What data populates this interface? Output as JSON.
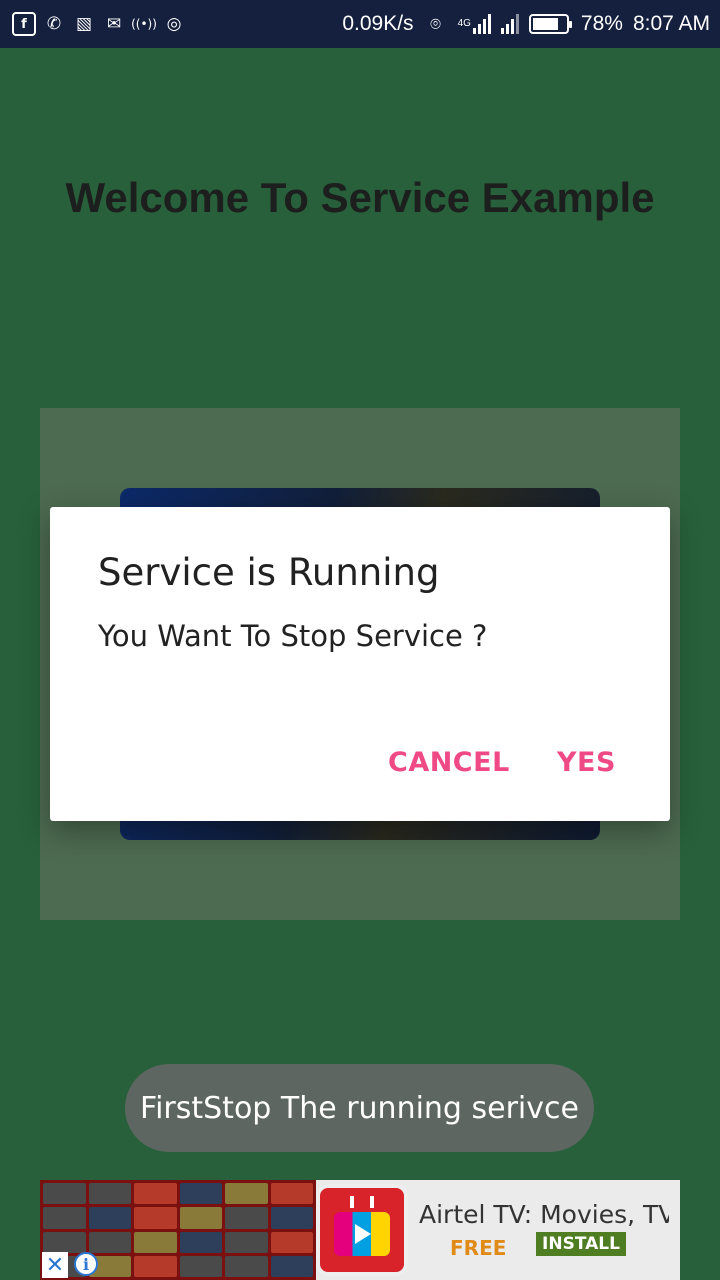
{
  "status_bar": {
    "left_icons": [
      {
        "name": "facebook-icon",
        "glyph": "f"
      },
      {
        "name": "whatsapp-icon",
        "glyph": "✆"
      },
      {
        "name": "gallery-icon",
        "glyph": "▧"
      },
      {
        "name": "mail-icon",
        "glyph": "✉"
      },
      {
        "name": "broadcast-icon",
        "glyph": "((•))"
      },
      {
        "name": "instagram-icon",
        "glyph": "◎"
      }
    ],
    "net_speed": "0.09K/s",
    "network_type": "4G",
    "battery_percent": "78%",
    "battery_level": 0.78,
    "time": "8:07 AM"
  },
  "app": {
    "title": "Welcome To Service Example"
  },
  "dialog": {
    "title": "Service is Running",
    "message": "You Want To Stop Service ?",
    "cancel_label": "CANCEL",
    "confirm_label": "YES"
  },
  "toast": {
    "text": "FirstStop The running serivce"
  },
  "ad": {
    "title": "Airtel TV: Movies, TV ...",
    "price": "FREE",
    "install_label": "INSTALL",
    "close_glyph": "✕",
    "info_glyph": "i"
  },
  "colors": {
    "background": "#27603a",
    "status_bar": "#15203f",
    "accent": "#ef4a85",
    "install_button": "#4e7d22",
    "free_text": "#e08a18"
  }
}
